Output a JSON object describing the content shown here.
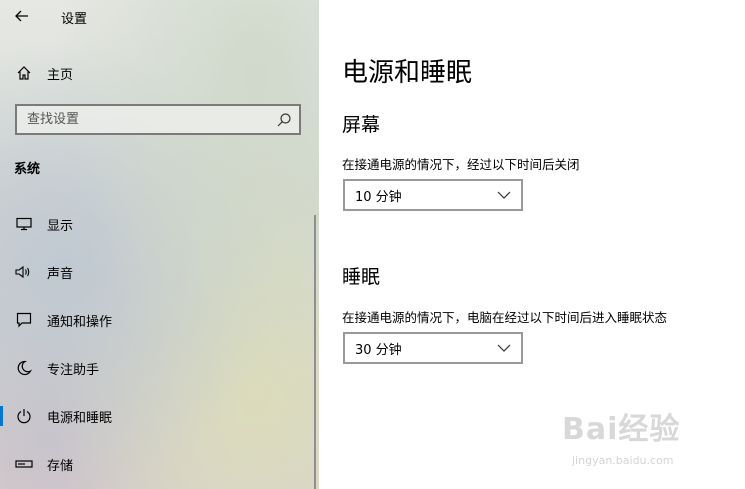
{
  "header": {
    "title": "设置"
  },
  "nav": {
    "home_label": "主页",
    "search_placeholder": "查找设置",
    "section_label": "系统",
    "items": [
      {
        "label": "显示",
        "icon": "monitor-icon"
      },
      {
        "label": "声音",
        "icon": "speaker-icon"
      },
      {
        "label": "通知和操作",
        "icon": "notification-icon"
      },
      {
        "label": "专注助手",
        "icon": "moon-icon"
      },
      {
        "label": "电源和睡眠",
        "icon": "power-icon",
        "active": true
      },
      {
        "label": "存储",
        "icon": "storage-icon"
      }
    ]
  },
  "main": {
    "title": "电源和睡眠",
    "screen": {
      "heading": "屏幕",
      "description": "在接通电源的情况下，经过以下时间后关闭",
      "value": "10 分钟"
    },
    "sleep": {
      "heading": "睡眠",
      "description": "在接通电源的情况下，电脑在经过以下时间后进入睡眠状态",
      "value": "30 分钟"
    }
  },
  "watermark": {
    "logo": "Bai经验",
    "sub": "jingyan.baidu.com"
  },
  "colors": {
    "accent": "#0078d7",
    "dropdown_border": "#999999"
  }
}
